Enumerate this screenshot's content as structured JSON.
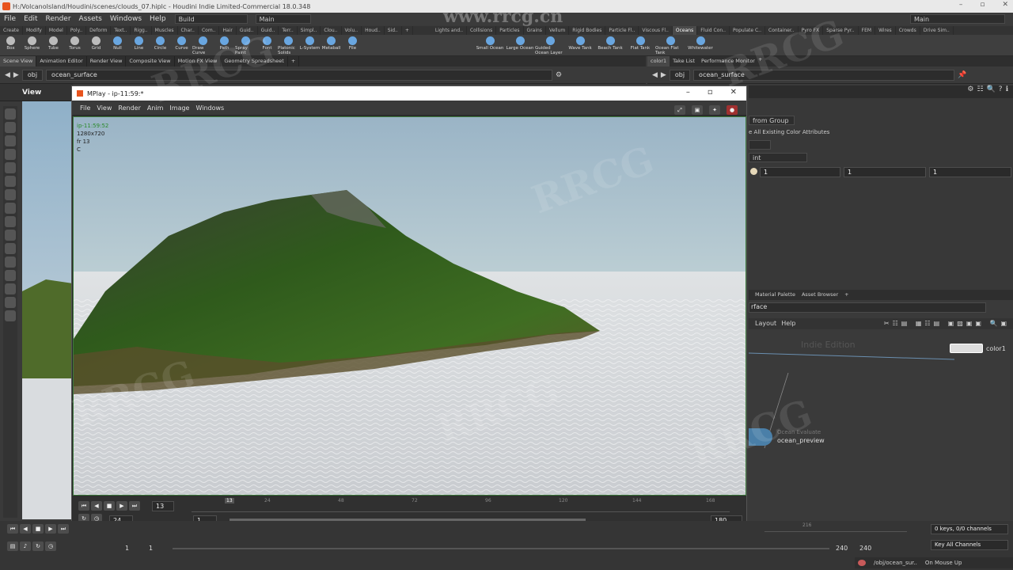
{
  "window": {
    "title": "H:/VolcanoIsland/Houdini/scenes/clouds_07.hiplc - Houdini Indie Limited-Commercial 18.0.348"
  },
  "menubar": {
    "items": [
      "File",
      "Edit",
      "Render",
      "Assets",
      "Windows",
      "Help"
    ],
    "desktop": "Build",
    "right_desktop": "Main",
    "center_desktop": "Main"
  },
  "shelf": {
    "tabs_left": [
      "Create",
      "Modify",
      "Model",
      "Poly..",
      "Deform",
      "Text..",
      "Rigg..",
      "Muscles",
      "Char..",
      "Com..",
      "Hair",
      "Guid..",
      "Guid..",
      "Terr..",
      "Simpl..",
      "Clou..",
      "Volu..",
      "Houd..",
      "Sid.."
    ],
    "tabs_right": [
      "Lights and..",
      "Collisions",
      "Particles",
      "Grains",
      "Vellum",
      "Rigid Bodies",
      "Particle Fl..",
      "Viscous Fl..",
      "Oceans",
      "Fluid Con..",
      "Populate C..",
      "Container..",
      "Pyro FX",
      "Sparse Pyr..",
      "FEM",
      "Wires",
      "Crowds",
      "Drive Sim.."
    ],
    "tools_left": [
      "Box",
      "Sphere",
      "Tube",
      "Torus",
      "Grid",
      "Null",
      "Line",
      "Circle",
      "Curve",
      "Draw Curve",
      "Path",
      "Spray Paint",
      "Font",
      "Platonic Solids",
      "L-System",
      "Metaball",
      "File"
    ],
    "tools_right": [
      "Small Ocean",
      "Large Ocean",
      "Guided Ocean Layer",
      "Wave Tank",
      "Beach Tank",
      "Flat Tank",
      "Ocean Flat Tank",
      "Whitewater"
    ]
  },
  "panel_tabs_left": [
    "Scene View",
    "Animation Editor",
    "Render View",
    "Composite View",
    "Motion FX View",
    "Geometry Spreadsheet"
  ],
  "panel_tabs_right": [
    "color1",
    "Take List",
    "Performance Monitor"
  ],
  "path_left": {
    "root": "obj",
    "node": "ocean_surface"
  },
  "path_right": {
    "root": "obj",
    "node": "ocean_surface"
  },
  "viewport_label": "View",
  "mplay": {
    "title": "MPlay - ip-11:59:*",
    "menu": [
      "File",
      "View",
      "Render",
      "Anim",
      "Image",
      "Windows"
    ],
    "overlay": {
      "name": "ip-11:59:52",
      "res": "1280x720",
      "frame": "fr 13",
      "channel": "C"
    },
    "timeline": {
      "current": "13",
      "ticks": [
        "13",
        "24",
        "48",
        "72",
        "96",
        "120",
        "144",
        "168"
      ],
      "fps": "24",
      "start": "1",
      "end": "180"
    }
  },
  "params": {
    "group_label": "from Group",
    "color_attr": "e All Existing Color Attributes",
    "class": "int",
    "values": [
      "1",
      "1",
      "1"
    ]
  },
  "network": {
    "tabs": [
      "Material Palette",
      "Asset Browser"
    ],
    "path": "rface",
    "menu": [
      "Layout",
      "Help"
    ],
    "edition": "Indie Edition",
    "nodes": [
      {
        "name": "color1"
      },
      {
        "name": "ocean_preview",
        "type": "Ocean Evaluate"
      }
    ]
  },
  "bottom": {
    "frame": "1",
    "start": "1",
    "end": "240",
    "end2": "240",
    "tick": "216",
    "keys": "0 keys, 0/0 channels",
    "keyall": "Key All Channels",
    "status_path": "/obj/ocean_sur..",
    "mouse": "On Mouse Up"
  },
  "watermark": {
    "site": "www.rrcg.cn"
  }
}
